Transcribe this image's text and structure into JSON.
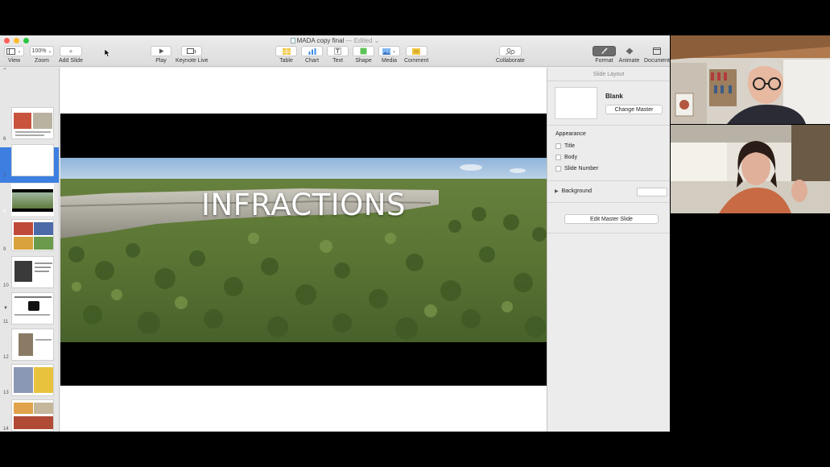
{
  "window": {
    "title": "MADA copy final",
    "edited_label": "— Edited"
  },
  "toolbar": {
    "view_label": "View",
    "zoom_value": "100%",
    "zoom_label": "Zoom",
    "add_slide_label": "Add Slide",
    "play_label": "Play",
    "keynote_live_label": "Keynote Live",
    "table_label": "Table",
    "chart_label": "Chart",
    "text_label": "Text",
    "shape_label": "Shape",
    "media_label": "Media",
    "comment_label": "Comment",
    "collaborate_label": "Collaborate",
    "format_label": "Format",
    "animate_label": "Animate",
    "document_label": "Document"
  },
  "navigator": {
    "selected_slide": 8,
    "slides": [
      {
        "number": "5"
      },
      {
        "number": "6"
      },
      {
        "number": "7"
      },
      {
        "number": "8"
      },
      {
        "number": "9"
      },
      {
        "number": "10"
      },
      {
        "number": "11"
      },
      {
        "number": "12"
      },
      {
        "number": "13"
      },
      {
        "number": "14"
      },
      {
        "number": "15"
      }
    ]
  },
  "slide": {
    "title": "INFRACTIONS"
  },
  "inspector": {
    "header": "Slide Layout",
    "master_name": "Blank",
    "change_master_label": "Change Master",
    "appearance_label": "Appearance",
    "title_option": "Title",
    "body_option": "Body",
    "slide_number_option": "Slide Number",
    "background_label": "Background",
    "edit_master_label": "Edit Master Slide"
  },
  "colors": {
    "selection": "#3d7fe0",
    "toolbar_bg": "#ececec",
    "format_selected": "#6c6c6c"
  },
  "icons": {
    "play": "play-triangle-icon",
    "table": "table-icon",
    "chart": "bar-chart-icon",
    "text": "text-T-icon",
    "shape": "square-shape-icon",
    "media": "image-icon",
    "comment": "comment-icon",
    "collaborate": "people-icon",
    "format": "paintbrush-icon",
    "animate": "diamond-icon",
    "document": "document-icon"
  }
}
